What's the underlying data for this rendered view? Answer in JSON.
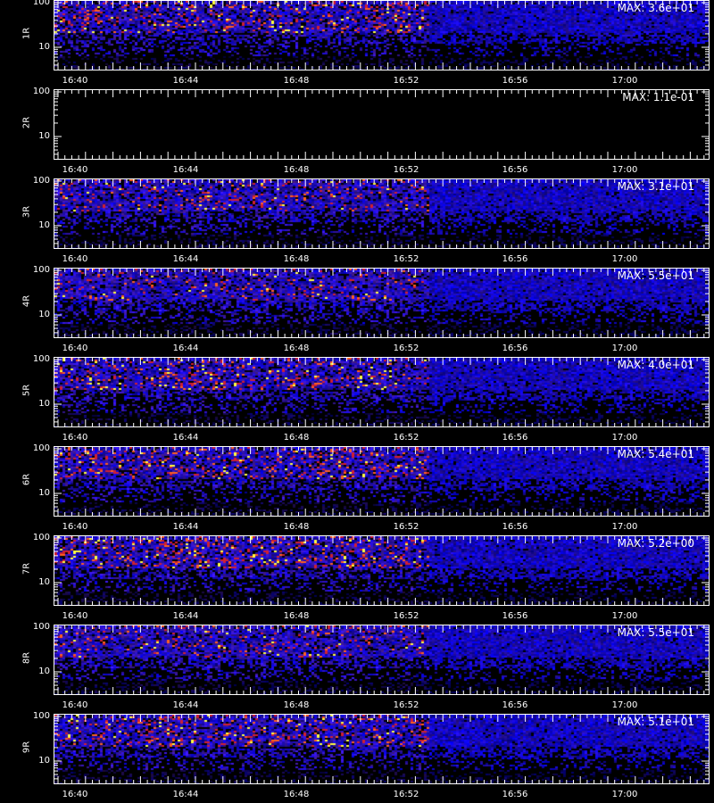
{
  "chart_data": {
    "type": "heatmap",
    "x_ticks": [
      "16:40",
      "16:44",
      "16:48",
      "16:52",
      "16:56",
      "17:00"
    ],
    "y_ticks": [
      "100",
      "10"
    ],
    "panels": [
      {
        "label": "1R",
        "max": "MAX: 3.6e+01",
        "intensity": 0.85
      },
      {
        "label": "2R",
        "max": "MAX: 1.1e-01",
        "intensity": 0.0
      },
      {
        "label": "3R",
        "max": "MAX: 3.1e+01",
        "intensity": 0.65
      },
      {
        "label": "4R",
        "max": "MAX: 5.5e+01",
        "intensity": 0.45
      },
      {
        "label": "5R",
        "max": "MAX: 4.0e+01",
        "intensity": 0.8
      },
      {
        "label": "6R",
        "max": "MAX: 5.4e+01",
        "intensity": 0.9
      },
      {
        "label": "7R",
        "max": "MAX: 5.2e+00",
        "intensity": 1.0
      },
      {
        "label": "8R",
        "max": "MAX: 5.5e+01",
        "intensity": 0.5
      },
      {
        "label": "9R",
        "max": "MAX: 5.1e+01",
        "intensity": 0.85
      }
    ]
  },
  "colors": {
    "background": "#000000",
    "low": "#1a1aa0",
    "mid": "#3c3cff",
    "high": "#ff2020",
    "peak": "#ffff40"
  },
  "footer": {
    "text": ""
  }
}
